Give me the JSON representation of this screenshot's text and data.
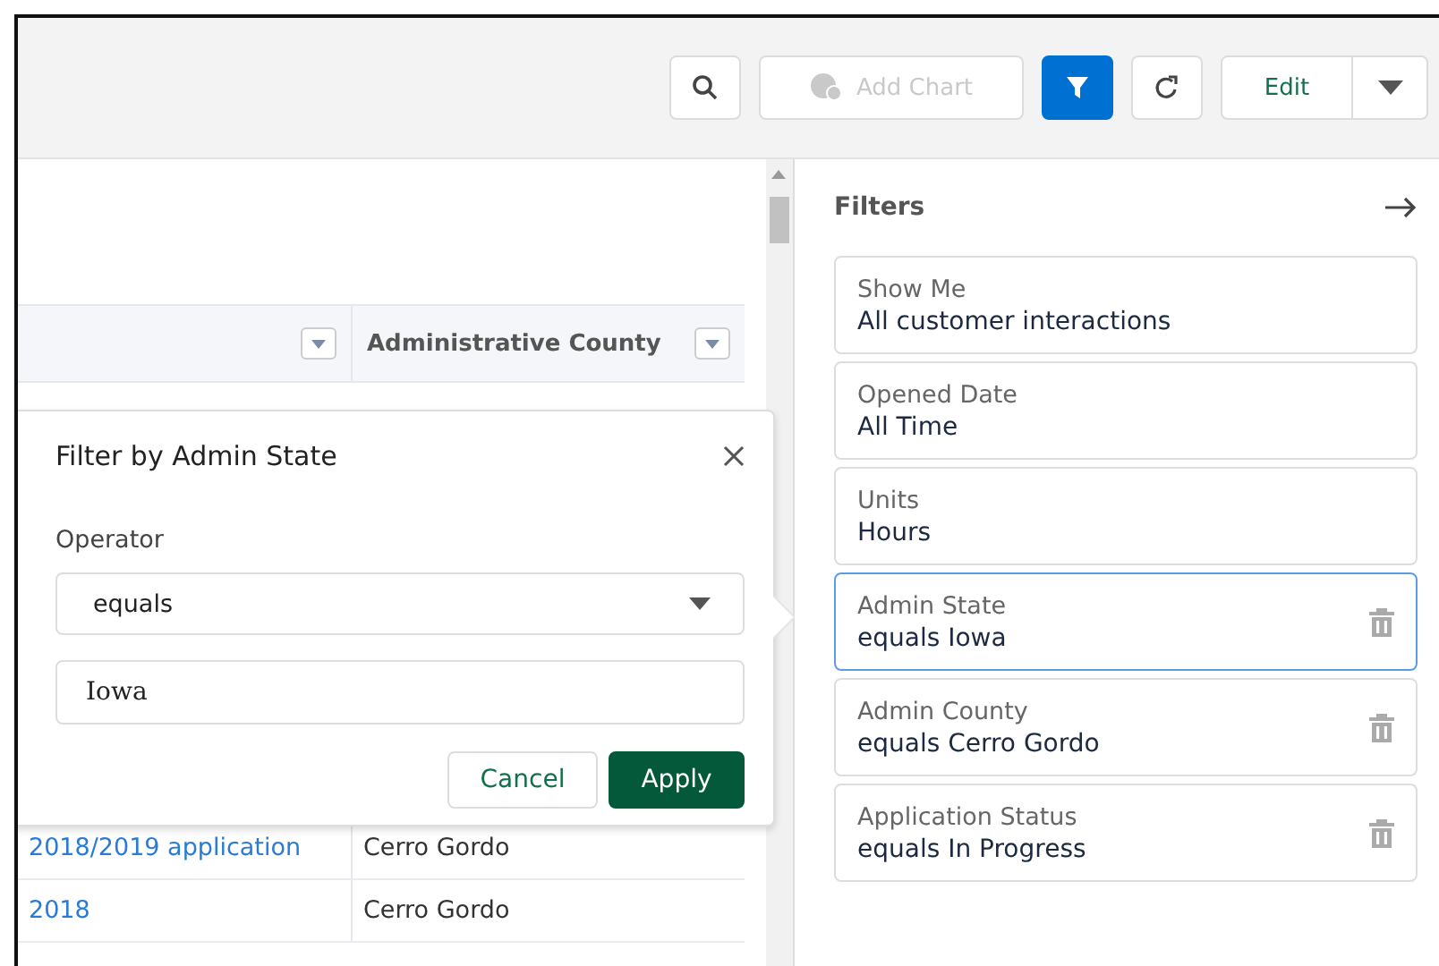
{
  "toolbar": {
    "add_chart": "Add Chart",
    "filter_selected": true,
    "edit": "Edit"
  },
  "table": {
    "columns": [
      {},
      {
        "label": "Administrative County"
      }
    ],
    "rows": [
      {
        "cells": [
          "2018/2019 application",
          "Cerro Gordo"
        ]
      },
      {
        "cells": [
          "2018",
          "Cerro Gordo"
        ]
      }
    ]
  },
  "popover": {
    "title": "Filter by Admin State",
    "operator_label": "Operator",
    "operator": "equals",
    "value": "Iowa",
    "cancel": "Cancel",
    "apply": "Apply"
  },
  "filters": {
    "title": "Filters",
    "items": [
      {
        "label": "Show Me",
        "value": "All customer interactions",
        "selected": false,
        "removable": false
      },
      {
        "label": "Opened Date",
        "value": "All Time",
        "selected": false,
        "removable": false
      },
      {
        "label": "Units",
        "value": "Hours",
        "selected": false,
        "removable": false
      },
      {
        "label": "Admin State",
        "value": "equals Iowa",
        "selected": true,
        "removable": true
      },
      {
        "label": "Admin County",
        "value": "equals Cerro Gordo",
        "selected": false,
        "removable": true
      },
      {
        "label": "Application Status",
        "value": "equals In Progress",
        "selected": false,
        "removable": true
      }
    ]
  }
}
